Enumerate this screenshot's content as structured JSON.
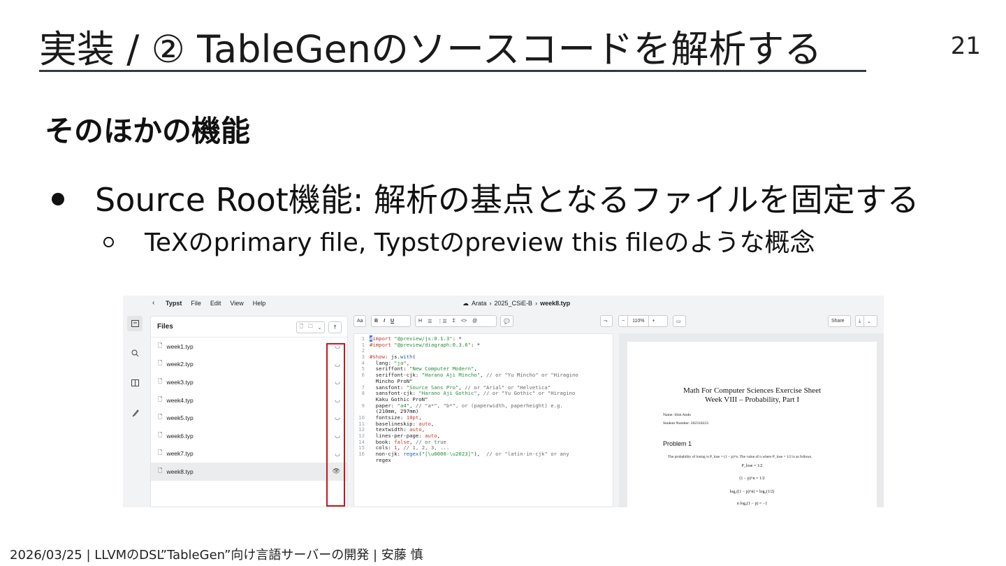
{
  "slide": {
    "title": "実装 / ② TableGenのソースコードを解析する",
    "page_number": "21",
    "section_heading": "そのほかの機能",
    "bullet_main": "Source Root機能: 解析の基点となるファイルを固定する",
    "bullet_sub": "TeXのprimary file, Typstのpreview this fileのような概念",
    "footer": "2026/03/25 | LLVMのDSL”TableGen”向け言語サーバーの開発 | 安藤 慎"
  },
  "app": {
    "back_icon": "‹",
    "menu": [
      "Typst",
      "File",
      "Edit",
      "View",
      "Help"
    ],
    "breadcrumb": {
      "cloud_icon": "☁",
      "owner": "Arata",
      "sep1": "›",
      "project": "2025_CSiE-B",
      "sep2": "›",
      "file": "week8.typ"
    },
    "rail_icons": [
      "files-icon",
      "search-icon",
      "book-icon",
      "brush-icon"
    ],
    "files_panel": {
      "title": "Files",
      "items": [
        {
          "name": "week1.typ",
          "action": "◡"
        },
        {
          "name": "week2.typ",
          "action": "◡"
        },
        {
          "name": "week3.typ",
          "action": "◡"
        },
        {
          "name": "week4.typ",
          "action": "◡"
        },
        {
          "name": "week5.typ",
          "action": "◡"
        },
        {
          "name": "week6.typ",
          "action": "◡"
        },
        {
          "name": "week7.typ",
          "action": "◡"
        },
        {
          "name": "week8.typ",
          "action": "👁"
        }
      ]
    },
    "toolbar": {
      "aa": "Aa",
      "bold": "B",
      "italic": "I",
      "underline": "U",
      "heading": "H",
      "bullet_list": "☰",
      "numbered_list": "⋮☰",
      "sum": "Σ",
      "code": "<>",
      "at": "@",
      "comment": "💬",
      "redo": "⤳",
      "zoom_out": "−",
      "zoom": "110%",
      "zoom_in": "+",
      "frame": "▭",
      "share": "Share",
      "export": "⤓",
      "export_menu": "⌄"
    },
    "code": [
      {
        "n": "1",
        "t": "import \"@preview/js:0.1.3\": *"
      },
      {
        "n": "1",
        "t": "#import \"@preview/diagraph:0.3.6\": *"
      },
      {
        "n": "2",
        "t": ""
      },
      {
        "n": "3",
        "t": "#show: js.with("
      },
      {
        "n": "4",
        "t": "  lang: \"ja\","
      },
      {
        "n": "5",
        "t": "  seriffont: \"New Computer Modern\","
      },
      {
        "n": "6",
        "t": "  seriffont-cjk: \"Harano Aji Mincho\", // or \"Yu Mincho\" or \"Hiragino"
      },
      {
        "n": "",
        "t": "  Mincho ProN\""
      },
      {
        "n": "7",
        "t": "  sansfont: \"Source Sans Pro\", // or \"Arial\" or \"Helvetica\""
      },
      {
        "n": "8",
        "t": "  sansfont-cjk: \"Harano Aji Gothic\", // or \"Yu Gothic\" or \"Hiragino"
      },
      {
        "n": "",
        "t": "  Kaku Gothic ProN\""
      },
      {
        "n": "9",
        "t": "  paper: \"a4\", // \"a*\", \"b*\", or (paperwidth, paperheight) e.g."
      },
      {
        "n": "",
        "t": "  (210mm, 297mm)"
      },
      {
        "n": "10",
        "t": "  fontsize: 10pt,"
      },
      {
        "n": "11",
        "t": "  baselineskip: auto,"
      },
      {
        "n": "12",
        "t": "  textwidth: auto,"
      },
      {
        "n": "13",
        "t": "  lines-per-page: auto,"
      },
      {
        "n": "14",
        "t": "  book: false, // or true"
      },
      {
        "n": "15",
        "t": "  cols: 1, // 1, 2, 3, ..."
      },
      {
        "n": "16",
        "t": "  non-cjk: regex(\"[\\u0000-\\u2023]\"),  // or \"latin-in-cjk\" or any"
      },
      {
        "n": "",
        "t": "  regex"
      }
    ],
    "preview": {
      "title_line1": "Math For Computer Sciences Exercise Sheet",
      "title_line2": "Week VIII – Probability, Part I",
      "name_line": "Name: Shin Ando",
      "student_line": "Student Number: 202310223",
      "problem": "Problem 1",
      "problem_text": "The probability of losing is P_lose = (1 − p)^n. The value of n where P_lose = 1/2 is as follows.",
      "eq1": "P_lose = 1/2",
      "eq2": "(1 − p)^n = 1/2",
      "eq3": "log₂((1 − p)^n) = log₂(1/2)",
      "eq4": "n log₂(1 − p) = −1"
    }
  }
}
